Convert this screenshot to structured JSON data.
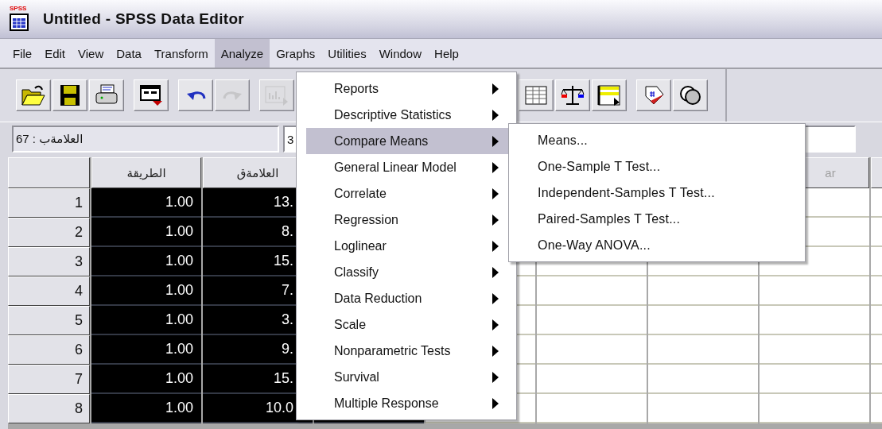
{
  "window": {
    "title": "Untitled - SPSS Data Editor",
    "icon_label": "SPSS"
  },
  "menubar": [
    {
      "label": "File",
      "selected": false
    },
    {
      "label": "Edit",
      "selected": false
    },
    {
      "label": "View",
      "selected": false
    },
    {
      "label": "Data",
      "selected": false
    },
    {
      "label": "Transform",
      "selected": false
    },
    {
      "label": "Analyze",
      "selected": true
    },
    {
      "label": "Graphs",
      "selected": false
    },
    {
      "label": "Utilities",
      "selected": false
    },
    {
      "label": "Window",
      "selected": false
    },
    {
      "label": "Help",
      "selected": false
    }
  ],
  "toolbar": {
    "left": [
      [
        {
          "kind": "open",
          "disabled": false
        },
        {
          "kind": "save",
          "disabled": false
        },
        {
          "kind": "print",
          "disabled": false
        }
      ],
      [
        {
          "kind": "goto",
          "disabled": false
        }
      ],
      [
        {
          "kind": "undo",
          "disabled": false
        },
        {
          "kind": "redo",
          "disabled": true
        }
      ],
      [
        {
          "kind": "chart",
          "disabled": true
        }
      ]
    ],
    "right": [
      [
        {
          "kind": "grid",
          "disabled": false
        },
        {
          "kind": "scale",
          "disabled": false
        },
        {
          "kind": "select",
          "disabled": false
        }
      ],
      [
        {
          "kind": "tag",
          "disabled": false
        },
        {
          "kind": "sets",
          "disabled": false
        }
      ]
    ]
  },
  "cell_editor": {
    "cell": "67 : العلامةب",
    "value": "3"
  },
  "grid": {
    "columns": [
      {
        "label": "الطريقة",
        "selected": true
      },
      {
        "label": "العلامةق",
        "selected": true
      },
      {
        "selected": true
      },
      {
        "selected": false
      },
      {
        "selected": false
      },
      {
        "selected": false
      },
      {
        "label": "ar",
        "selected": false
      },
      {
        "selected": false
      }
    ],
    "rows": [
      {
        "number": "1",
        "cells": [
          "1.00",
          "13."
        ]
      },
      {
        "number": "2",
        "cells": [
          "1.00",
          "8."
        ]
      },
      {
        "number": "3",
        "cells": [
          "1.00",
          "15."
        ]
      },
      {
        "number": "4",
        "cells": [
          "1.00",
          "7."
        ]
      },
      {
        "number": "5",
        "cells": [
          "1.00",
          "3."
        ]
      },
      {
        "number": "6",
        "cells": [
          "1.00",
          "9."
        ]
      },
      {
        "number": "7",
        "cells": [
          "1.00",
          "15."
        ]
      },
      {
        "number": "8",
        "cells": [
          "1.00",
          "10.0"
        ]
      }
    ]
  },
  "analyze_menu": [
    {
      "label": "Reports",
      "selected": false
    },
    {
      "label": "Descriptive Statistics",
      "selected": false
    },
    {
      "label": "Compare Means",
      "selected": true
    },
    {
      "label": "General Linear Model",
      "selected": false
    },
    {
      "label": "Correlate",
      "selected": false
    },
    {
      "label": "Regression",
      "selected": false
    },
    {
      "label": "Loglinear",
      "selected": false
    },
    {
      "label": "Classify",
      "selected": false
    },
    {
      "label": "Data Reduction",
      "selected": false
    },
    {
      "label": "Scale",
      "selected": false
    },
    {
      "label": "Nonparametric Tests",
      "selected": false
    },
    {
      "label": "Survival",
      "selected": false
    },
    {
      "label": "Multiple Response",
      "selected": false
    }
  ],
  "compare_means_submenu": [
    {
      "label": "Means..."
    },
    {
      "label": "One-Sample T Test..."
    },
    {
      "label": "Independent-Samples T Test..."
    },
    {
      "label": "Paired-Samples T Test..."
    },
    {
      "label": "One-Way ANOVA..."
    }
  ]
}
